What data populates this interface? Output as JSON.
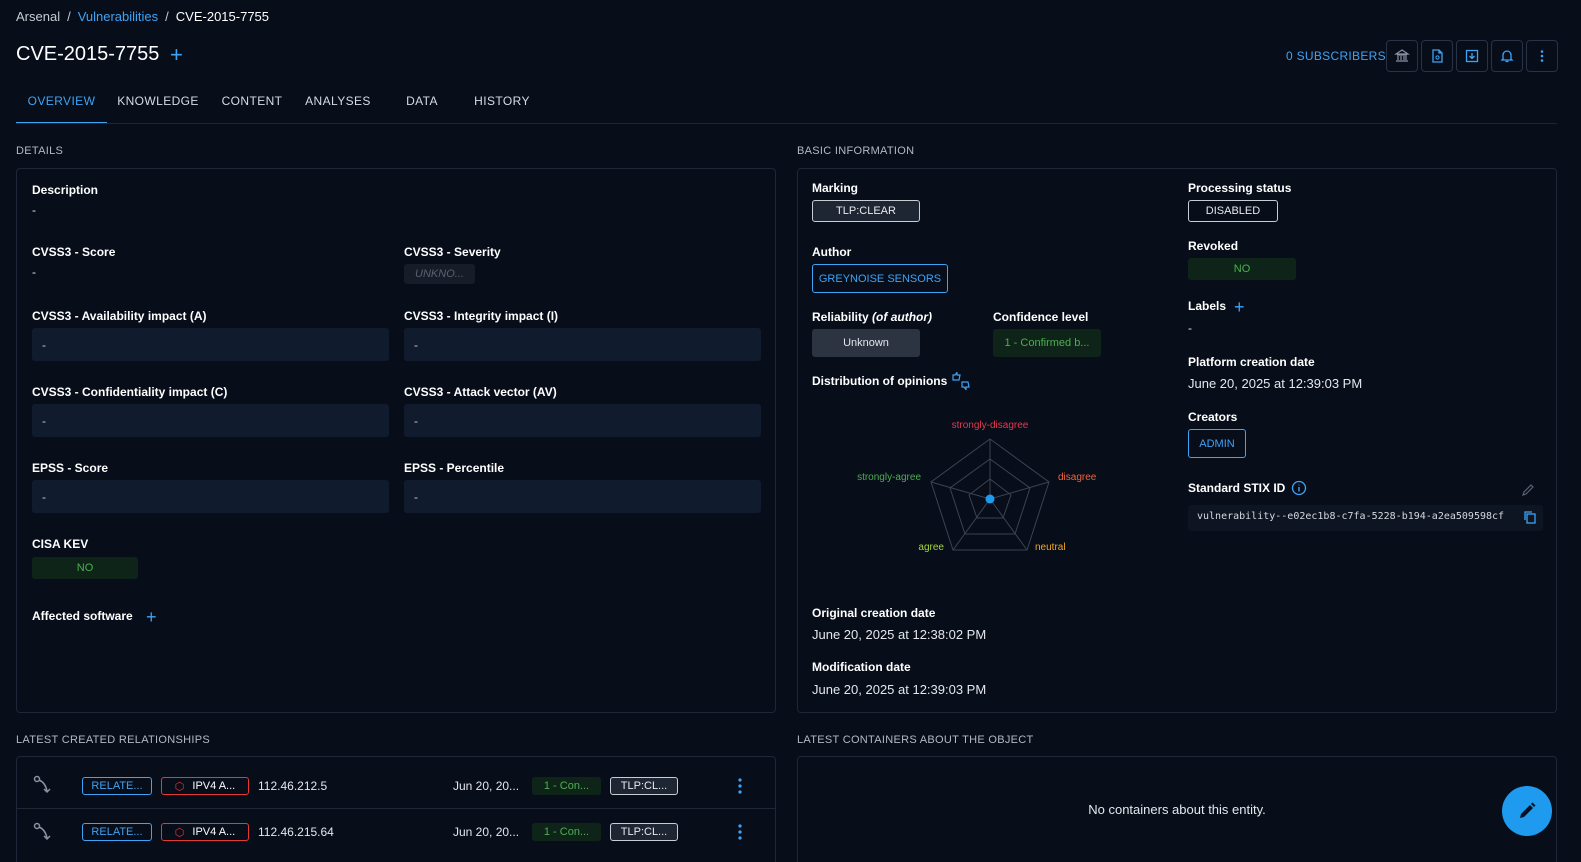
{
  "breadcrumb": {
    "root": "Arsenal",
    "section": "Vulnerabilities",
    "current": "CVE-2015-7755"
  },
  "header": {
    "title": "CVE-2015-7755",
    "subscribers": "0 SUBSCRIBERS"
  },
  "tabs": [
    "OVERVIEW",
    "KNOWLEDGE",
    "CONTENT",
    "ANALYSES",
    "DATA",
    "HISTORY"
  ],
  "details": {
    "section_title": "DETAILS",
    "description_label": "Description",
    "description_value": "-",
    "cvss_score_label": "CVSS3 - Score",
    "cvss_score_value": "-",
    "cvss_severity_label": "CVSS3 - Severity",
    "cvss_severity_value": "UNKNO...",
    "availability_label": "CVSS3 - Availability impact (A)",
    "availability_value": "-",
    "integrity_label": "CVSS3 - Integrity impact (I)",
    "integrity_value": "-",
    "confidentiality_label": "CVSS3 - Confidentiality impact (C)",
    "confidentiality_value": "-",
    "attack_vector_label": "CVSS3 - Attack vector (AV)",
    "attack_vector_value": "-",
    "epss_score_label": "EPSS - Score",
    "epss_score_value": "-",
    "epss_percentile_label": "EPSS - Percentile",
    "epss_percentile_value": "-",
    "cisa_kev_label": "CISA KEV",
    "cisa_kev_value": "NO",
    "affected_software_label": "Affected software"
  },
  "basic": {
    "section_title": "BASIC INFORMATION",
    "marking_label": "Marking",
    "marking_value": "TLP:CLEAR",
    "author_label": "Author",
    "author_value": "GREYNOISE SENSORS",
    "reliability_label": "Reliability",
    "reliability_suffix": "(of author)",
    "reliability_value": "Unknown",
    "confidence_label": "Confidence level",
    "confidence_value": "1 - Confirmed b...",
    "opinions_label": "Distribution of opinions",
    "radar_axes": [
      "strongly-disagree",
      "disagree",
      "neutral",
      "agree",
      "strongly-agree"
    ],
    "radar_colors": [
      "#e53950",
      "#f0643a",
      "#f5a623",
      "#a5d63c",
      "#4caf50"
    ],
    "original_creation_label": "Original creation date",
    "original_creation_value": "June 20, 2025 at 12:38:02 PM",
    "modification_label": "Modification date",
    "modification_value": "June 20, 2025 at 12:39:03 PM",
    "processing_label": "Processing status",
    "processing_value": "DISABLED",
    "revoked_label": "Revoked",
    "revoked_value": "NO",
    "labels_label": "Labels",
    "labels_value": "-",
    "platform_creation_label": "Platform creation date",
    "platform_creation_value": "June 20, 2025 at 12:39:03 PM",
    "creators_label": "Creators",
    "creators_value": "ADMIN",
    "stix_label": "Standard STIX ID",
    "stix_value": "vulnerability--e02ec1b8-c7fa-5228-b194-a2ea509598cf"
  },
  "relationships": {
    "section_title": "LATEST CREATED RELATIONSHIPS",
    "rows": [
      {
        "type": "RELATE...",
        "entity": "IPV4 A...",
        "value": "112.46.212.5",
        "date": "Jun 20, 20...",
        "confidence": "1 - Con...",
        "marking": "TLP:CL..."
      },
      {
        "type": "RELATE...",
        "entity": "IPV4 A...",
        "value": "112.46.215.64",
        "date": "Jun 20, 20...",
        "confidence": "1 - Con...",
        "marking": "TLP:CL..."
      }
    ]
  },
  "containers": {
    "section_title": "LATEST CONTAINERS ABOUT THE OBJECT",
    "empty_text": "No containers about this entity."
  }
}
